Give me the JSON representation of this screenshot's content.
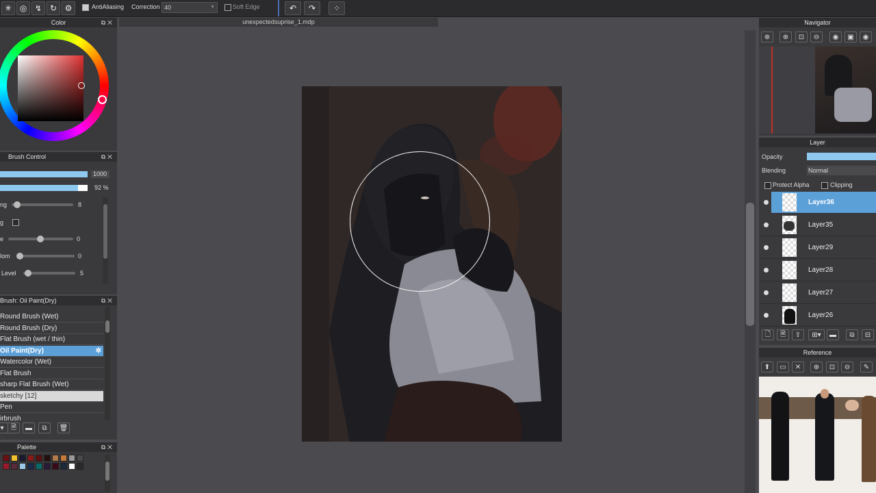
{
  "toolbar": {
    "antialiasing_label": "AntiAliasing",
    "correction_label": "Correction",
    "correction_value": "40",
    "soft_edge_label": "Soft Edge"
  },
  "document": {
    "tab_title": "unexpectedsuprise_1.mdp"
  },
  "color_panel": {
    "title": "Color",
    "accent": "#e03030"
  },
  "brush_control": {
    "title": "Brush Control",
    "size_value": "1000",
    "opacity_value": "92 %",
    "size_fraction": 1.0,
    "opacity_fraction": 0.92,
    "rows": [
      {
        "label": "ng",
        "value": "8"
      },
      {
        "label": "g",
        "value": ""
      },
      {
        "label": "e",
        "value": "0"
      },
      {
        "label": "lom",
        "value": "0"
      },
      {
        "label": "Level",
        "value": "5"
      }
    ]
  },
  "brush_list": {
    "title": "Brush: Oil Paint(Dry)",
    "items": [
      {
        "label": "Round Brush (Wet)"
      },
      {
        "label": "Round Brush (Dry)"
      },
      {
        "label": "Flat Brush (wet / thin)"
      },
      {
        "label": "Oil Paint(Dry)"
      },
      {
        "label": "Watercolor (Wet)"
      },
      {
        "label": "Flat Brush"
      },
      {
        "label": "sharp Flat Brush (Wet)"
      },
      {
        "label": "sketchy [12]"
      },
      {
        "label": "Pen"
      },
      {
        "label": "irbrush"
      }
    ]
  },
  "palette": {
    "title": "Palette",
    "colors": [
      "#6b0f12",
      "#f2c12e",
      "#1a1a2e",
      "#8a1a1a",
      "#5a1010",
      "#241010",
      "#b07a4a",
      "#c47a3a",
      "#9a9a9a",
      "#4a4a4a",
      "#9a1a2a",
      "#5a2a3a",
      "#9ac8e8",
      "#1a2a4a",
      "#0a6a6a",
      "#2a1a3a",
      "#3a0a1a",
      "#1a2a3a",
      "#ffffff",
      "#2a2a2a"
    ]
  },
  "navigator": {
    "title": "Navigator"
  },
  "layer_panel": {
    "title": "Layer",
    "opacity_label": "Opacity",
    "blending_label": "Blending",
    "blending_value": "Normal",
    "protect_alpha_label": "Protect Alpha",
    "clipping_label": "Clipping",
    "layers": [
      {
        "name": "Layer36"
      },
      {
        "name": "Layer35"
      },
      {
        "name": "Layer29"
      },
      {
        "name": "Layer28"
      },
      {
        "name": "Layer27"
      },
      {
        "name": "Layer26"
      }
    ]
  },
  "reference": {
    "title": "Reference"
  }
}
